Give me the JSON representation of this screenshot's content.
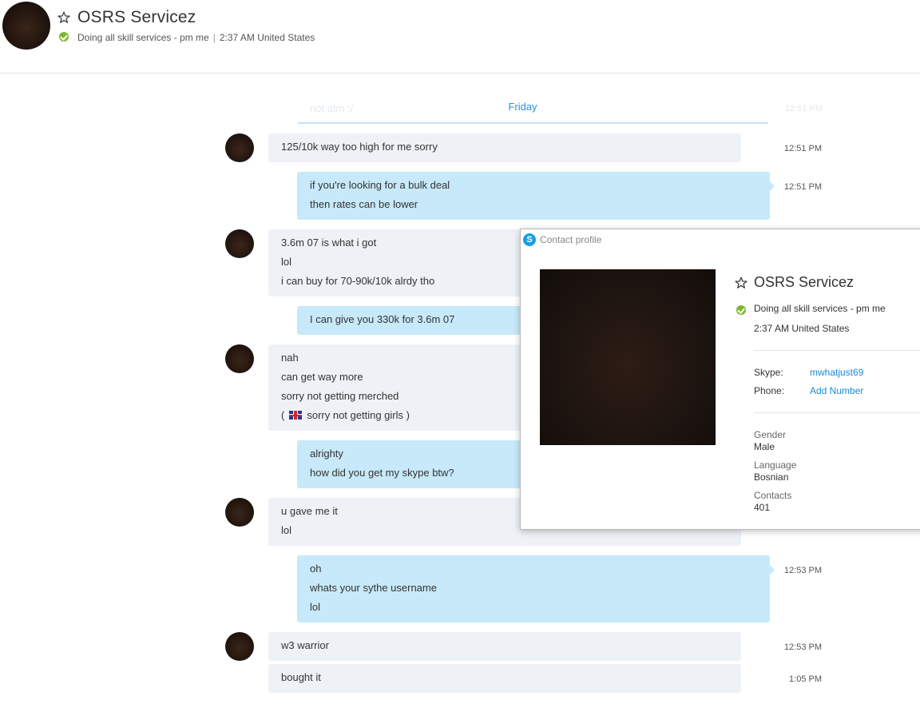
{
  "header": {
    "name": "OSRS Servicez",
    "mood": "Doing all skill services - pm me",
    "separator": "|",
    "local_time": "2:37 AM United States"
  },
  "divider": {
    "faded_text": "not atm :/",
    "faded_time": "12:51 PM",
    "day_label": "Friday"
  },
  "messages": [
    {
      "lines": [
        "125/10k way too high for me sorry"
      ],
      "time": "12:51 PM"
    },
    {
      "lines": [
        "if you're looking for a bulk deal",
        "then rates can be lower"
      ],
      "time": "12:51 PM"
    },
    {
      "lines": [
        "3.6m 07 is what i got",
        "lol",
        "i can buy for 70-90k/10k alrdy tho"
      ]
    },
    {
      "lines": [
        "I can give you 330k for 3.6m 07"
      ]
    },
    {
      "lines": [
        "nah",
        "can get way more",
        "sorry not getting merched",
        "(",
        "sorry not getting girls )"
      ]
    },
    {
      "lines": [
        "alrighty",
        "how did you get my skype btw?"
      ]
    },
    {
      "lines": [
        "u gave me it",
        "lol"
      ]
    },
    {
      "lines": [
        "oh",
        "whats your sythe username",
        "lol"
      ],
      "time": "12:53 PM"
    },
    {
      "lines": [
        "w3 warrior"
      ],
      "time": "12:53 PM"
    },
    {
      "lines": [
        "bought it"
      ],
      "time": "1:05 PM"
    }
  ],
  "profile": {
    "title": "Contact profile",
    "name": "OSRS Servicez",
    "mood": "Doing all skill services - pm me",
    "local_time": "2:37 AM United States",
    "skype_label": "Skype:",
    "skype_value": "mwhatjust69",
    "phone_label": "Phone:",
    "phone_value": "Add Number",
    "gender_label": "Gender",
    "gender_value": "Male",
    "language_label": "Language",
    "language_value": "Bosnian",
    "contacts_label": "Contacts",
    "contacts_value": "401"
  },
  "colors": {
    "incoming_bubble": "#eef1f6",
    "outgoing_bubble": "#c7e9f9",
    "online_status": "#7cb82f",
    "link": "#1c8ad6",
    "day_label": "#2a8fd8"
  },
  "icons": {
    "favorite": "star-outline-icon",
    "status": "online-check-icon",
    "skype": "skype-logo-icon",
    "flag": "uk-flag-emoticon-icon"
  }
}
